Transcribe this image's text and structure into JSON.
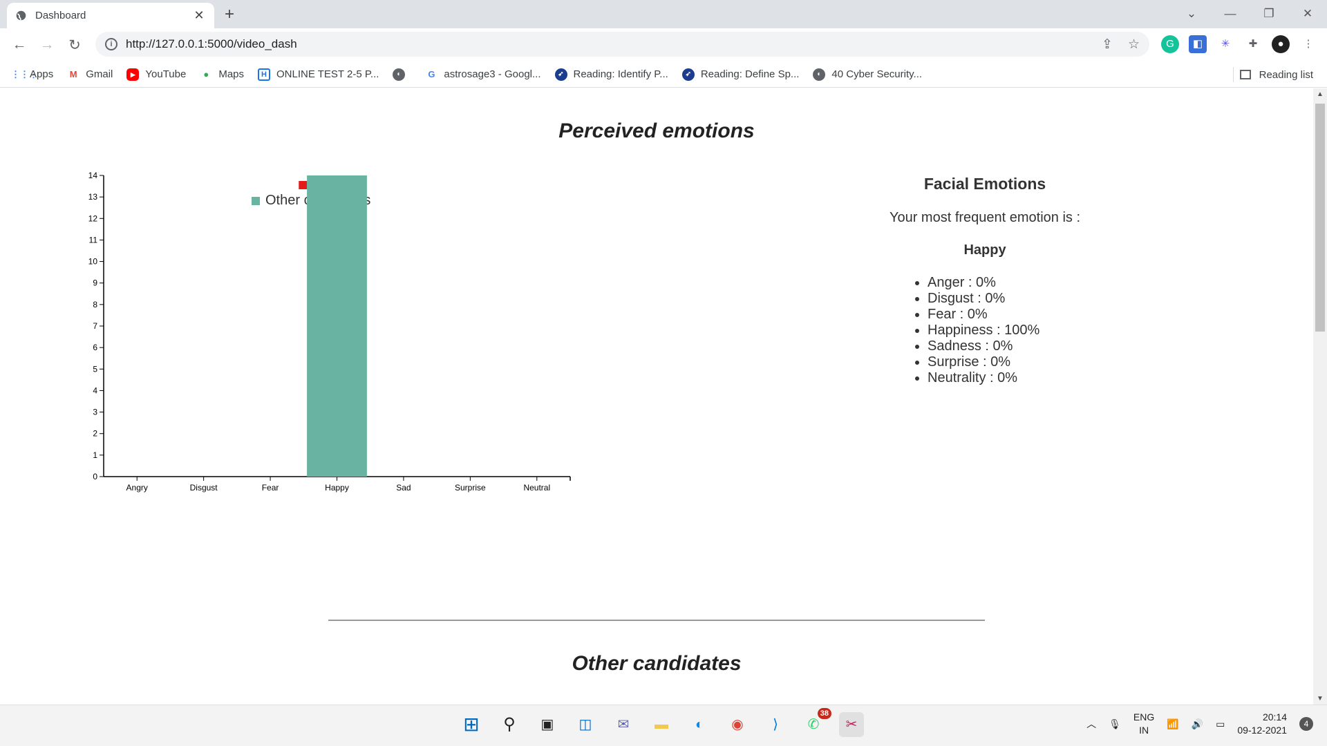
{
  "browser": {
    "tab_title": "Dashboard",
    "url": "http://127.0.0.1:5000/video_dash",
    "bookmarks": [
      {
        "label": "Apps",
        "icon": "apps-grid-icon"
      },
      {
        "label": "Gmail",
        "icon": "gmail-icon"
      },
      {
        "label": "YouTube",
        "icon": "youtube-icon"
      },
      {
        "label": "Maps",
        "icon": "maps-icon"
      },
      {
        "label": "ONLINE TEST 2-5 P...",
        "icon": "hackerrank-icon"
      },
      {
        "label": "",
        "icon": "globe-icon"
      },
      {
        "label": "astrosage3 - Googl...",
        "icon": "google-icon"
      },
      {
        "label": "Reading: Identify P...",
        "icon": "reading-icon"
      },
      {
        "label": "Reading: Define Sp...",
        "icon": "reading-icon"
      },
      {
        "label": "40 Cyber Security...",
        "icon": "globe-icon"
      }
    ],
    "reading_list": "Reading list"
  },
  "page": {
    "title": "Perceived emotions",
    "second_title": "Other candidates"
  },
  "chart_data": {
    "type": "bar",
    "categories": [
      "Angry",
      "Disgust",
      "Fear",
      "Happy",
      "Sad",
      "Surprise",
      "Neutral"
    ],
    "series": [
      {
        "name": "You",
        "color": "#e31a1c",
        "values": [
          0,
          0,
          0,
          0,
          0,
          0,
          0
        ]
      },
      {
        "name": "Other candidates",
        "color": "#69b3a2",
        "values": [
          0,
          0,
          0,
          14,
          0,
          0,
          0
        ]
      }
    ],
    "ylim": [
      0,
      14
    ],
    "yticks": [
      0,
      1,
      2,
      3,
      4,
      5,
      6,
      7,
      8,
      9,
      10,
      11,
      12,
      13,
      14
    ],
    "legend": "top"
  },
  "facial": {
    "heading": "Facial Emotions",
    "freq_text": "Your most frequent emotion is :",
    "top_emotion": "Happy",
    "items": [
      "Anger : 0%",
      "Disgust : 0%",
      "Fear : 0%",
      "Happiness : 100%",
      "Sadness : 0%",
      "Surprise : 0%",
      "Neutrality : 0%"
    ]
  },
  "taskbar": {
    "lang_top": "ENG",
    "lang_bottom": "IN",
    "time": "20:14",
    "date": "09-12-2021",
    "notif_count": "4",
    "whatsapp_badge": "38"
  }
}
